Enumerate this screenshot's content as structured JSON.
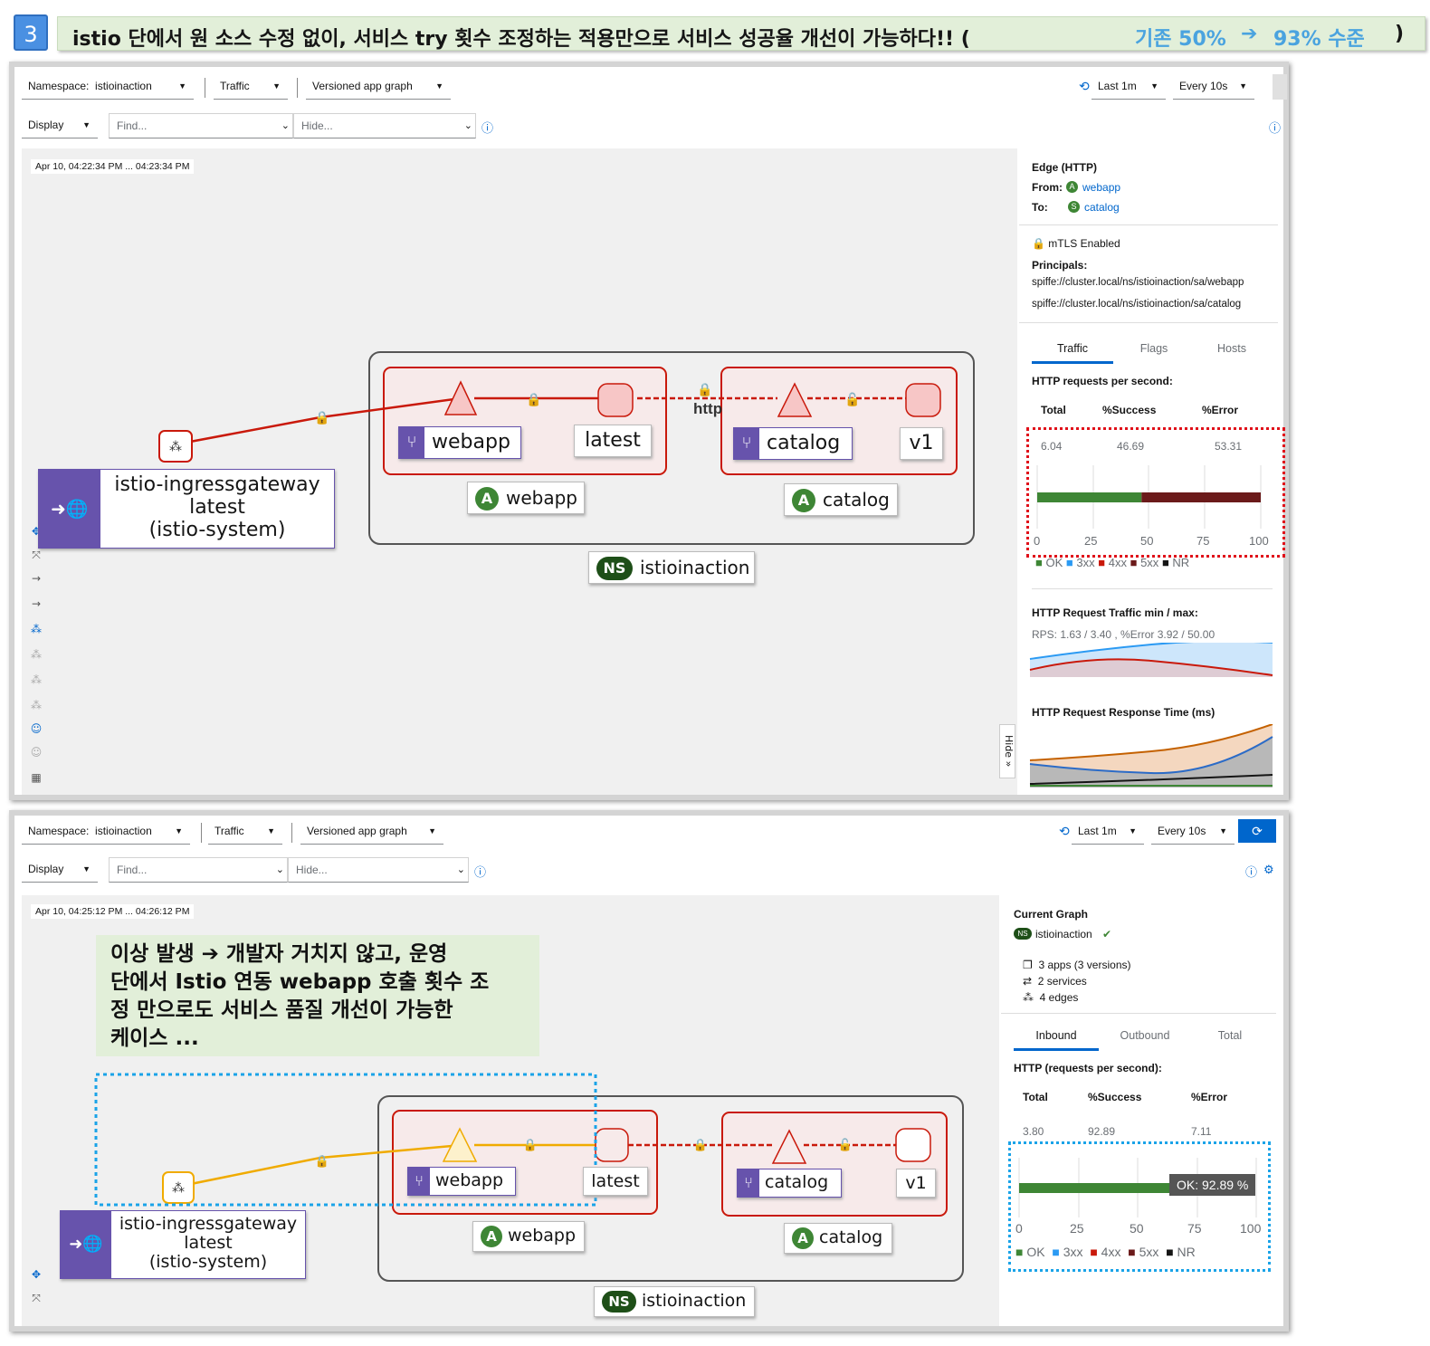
{
  "header": {
    "step_number": "3",
    "title_main": "istio 단에서 원 소스 수정 없이, 서비스 try 횟수 조정하는 적용만으로 서비스 성공율 개선이 가능하다!! (",
    "title_before": "기존 50%",
    "title_arrow": "➔",
    "title_after": "93% 수준",
    "title_close": ")"
  },
  "colors": {
    "accent": "#0066cc",
    "error_edge": "#c9190b",
    "ok_edge": "#f0ab00",
    "ok_bar": "#3e8635",
    "fivexx_bar": "#6b1a1a",
    "app_badge": "#1e4f18",
    "version_badge": "#6753ac",
    "gateway": "#6753ac"
  },
  "top": {
    "namespace_label": "Namespace:",
    "namespace_value": "istioinaction",
    "traffic": "Traffic",
    "graph_type": "Versioned app graph",
    "last": "Last 1m",
    "every": "Every 10s",
    "display": "Display",
    "find_placeholder": "Find...",
    "hide_placeholder": "Hide...",
    "timestamp": "Apr 10, 04:22:34 PM ... 04:23:34 PM",
    "side": {
      "edge_title": "Edge (HTTP)",
      "from_label": "From:",
      "from_value": "webapp",
      "to_label": "To:",
      "to_value": "catalog",
      "mtls": "mTLS Enabled",
      "principals_label": "Principals:",
      "principal1": "spiffe://cluster.local/ns/istioinaction/sa/webapp",
      "principal2": "spiffe://cluster.local/ns/istioinaction/sa/catalog",
      "tabs": [
        "Traffic",
        "Flags",
        "Hosts"
      ],
      "http_rps": "HTTP requests per second:",
      "col_total": "Total",
      "col_success": "%Success",
      "col_error": "%Error",
      "val_total": "6.04",
      "val_success": "46.69",
      "val_error": "53.31",
      "axis": [
        "0",
        "25",
        "50",
        "75",
        "100"
      ],
      "legend": [
        "OK",
        "3xx",
        "4xx",
        "5xx",
        "NR"
      ],
      "minmax_title": "HTTP Request Traffic min / max:",
      "minmax_value": "RPS: 1.63 / 3.40 , %Error 3.92 / 50.00",
      "resp_title": "HTTP Request Response Time (ms)",
      "hide": "Hide"
    }
  },
  "bottom": {
    "namespace_label": "Namespace:",
    "namespace_value": "istioinaction",
    "traffic": "Traffic",
    "graph_type": "Versioned app graph",
    "last": "Last 1m",
    "every": "Every 10s",
    "display": "Display",
    "find_placeholder": "Find...",
    "hide_placeholder": "Hide...",
    "timestamp": "Apr 10, 04:25:12 PM ... 04:26:12 PM",
    "note": [
      "이상 발생 ➔ 개발자 거치지 않고, 운영",
      "단에서 Istio 연동 webapp 호출 횟수 조",
      "정 만으로도 서비스 품질 개선이 가능한",
      "케이스 ..."
    ],
    "side": {
      "current_graph": "Current Graph",
      "ns": "istioinaction",
      "apps": "3 apps (3 versions)",
      "services": "2 services",
      "edges": "4 edges",
      "tabs": [
        "Inbound",
        "Outbound",
        "Total"
      ],
      "http_rps": "HTTP (requests per second):",
      "col_total": "Total",
      "col_success": "%Success",
      "col_error": "%Error",
      "val_total": "3.80",
      "val_success": "92.89",
      "val_error": "7.11",
      "tooltip": "OK: 92.89 %",
      "axis": [
        "0",
        "25",
        "50",
        "75",
        "100"
      ],
      "legend": [
        "OK",
        "3xx",
        "4xx",
        "5xx",
        "NR"
      ]
    }
  },
  "graph": {
    "gateway_line1": "istio-ingressgateway",
    "gateway_line2": "latest",
    "gateway_line3": "(istio-system)",
    "webapp": "webapp",
    "latest": "latest",
    "catalog": "catalog",
    "v1": "v1",
    "app_badge": "A",
    "ns_badge": "NS",
    "namespace": "istioinaction",
    "http": "http"
  }
}
